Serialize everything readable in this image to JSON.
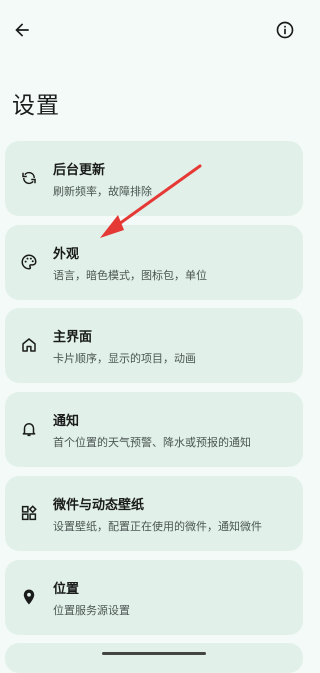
{
  "page": {
    "title": "设置"
  },
  "topbar": {
    "back_icon": "arrow-left-icon",
    "info_icon": "info-icon"
  },
  "settings_items": [
    {
      "title": "后台更新",
      "subtitle": "刷新频率，故障排除",
      "icon": "sync-icon"
    },
    {
      "title": "外观",
      "subtitle": "语言，暗色模式，图标包，单位",
      "icon": "palette-icon"
    },
    {
      "title": "主界面",
      "subtitle": "卡片顺序，显示的项目，动画",
      "icon": "home-icon"
    },
    {
      "title": "通知",
      "subtitle": "首个位置的天气预警、降水或预报的通知",
      "icon": "bell-icon"
    },
    {
      "title": "微件与动态壁纸",
      "subtitle": "设置壁纸，配置正在使用的微件，通知微件",
      "icon": "widgets-icon"
    },
    {
      "title": "位置",
      "subtitle": "位置服务源设置",
      "icon": "location-pin-icon"
    }
  ],
  "annotation": {
    "color": "#e53935"
  }
}
